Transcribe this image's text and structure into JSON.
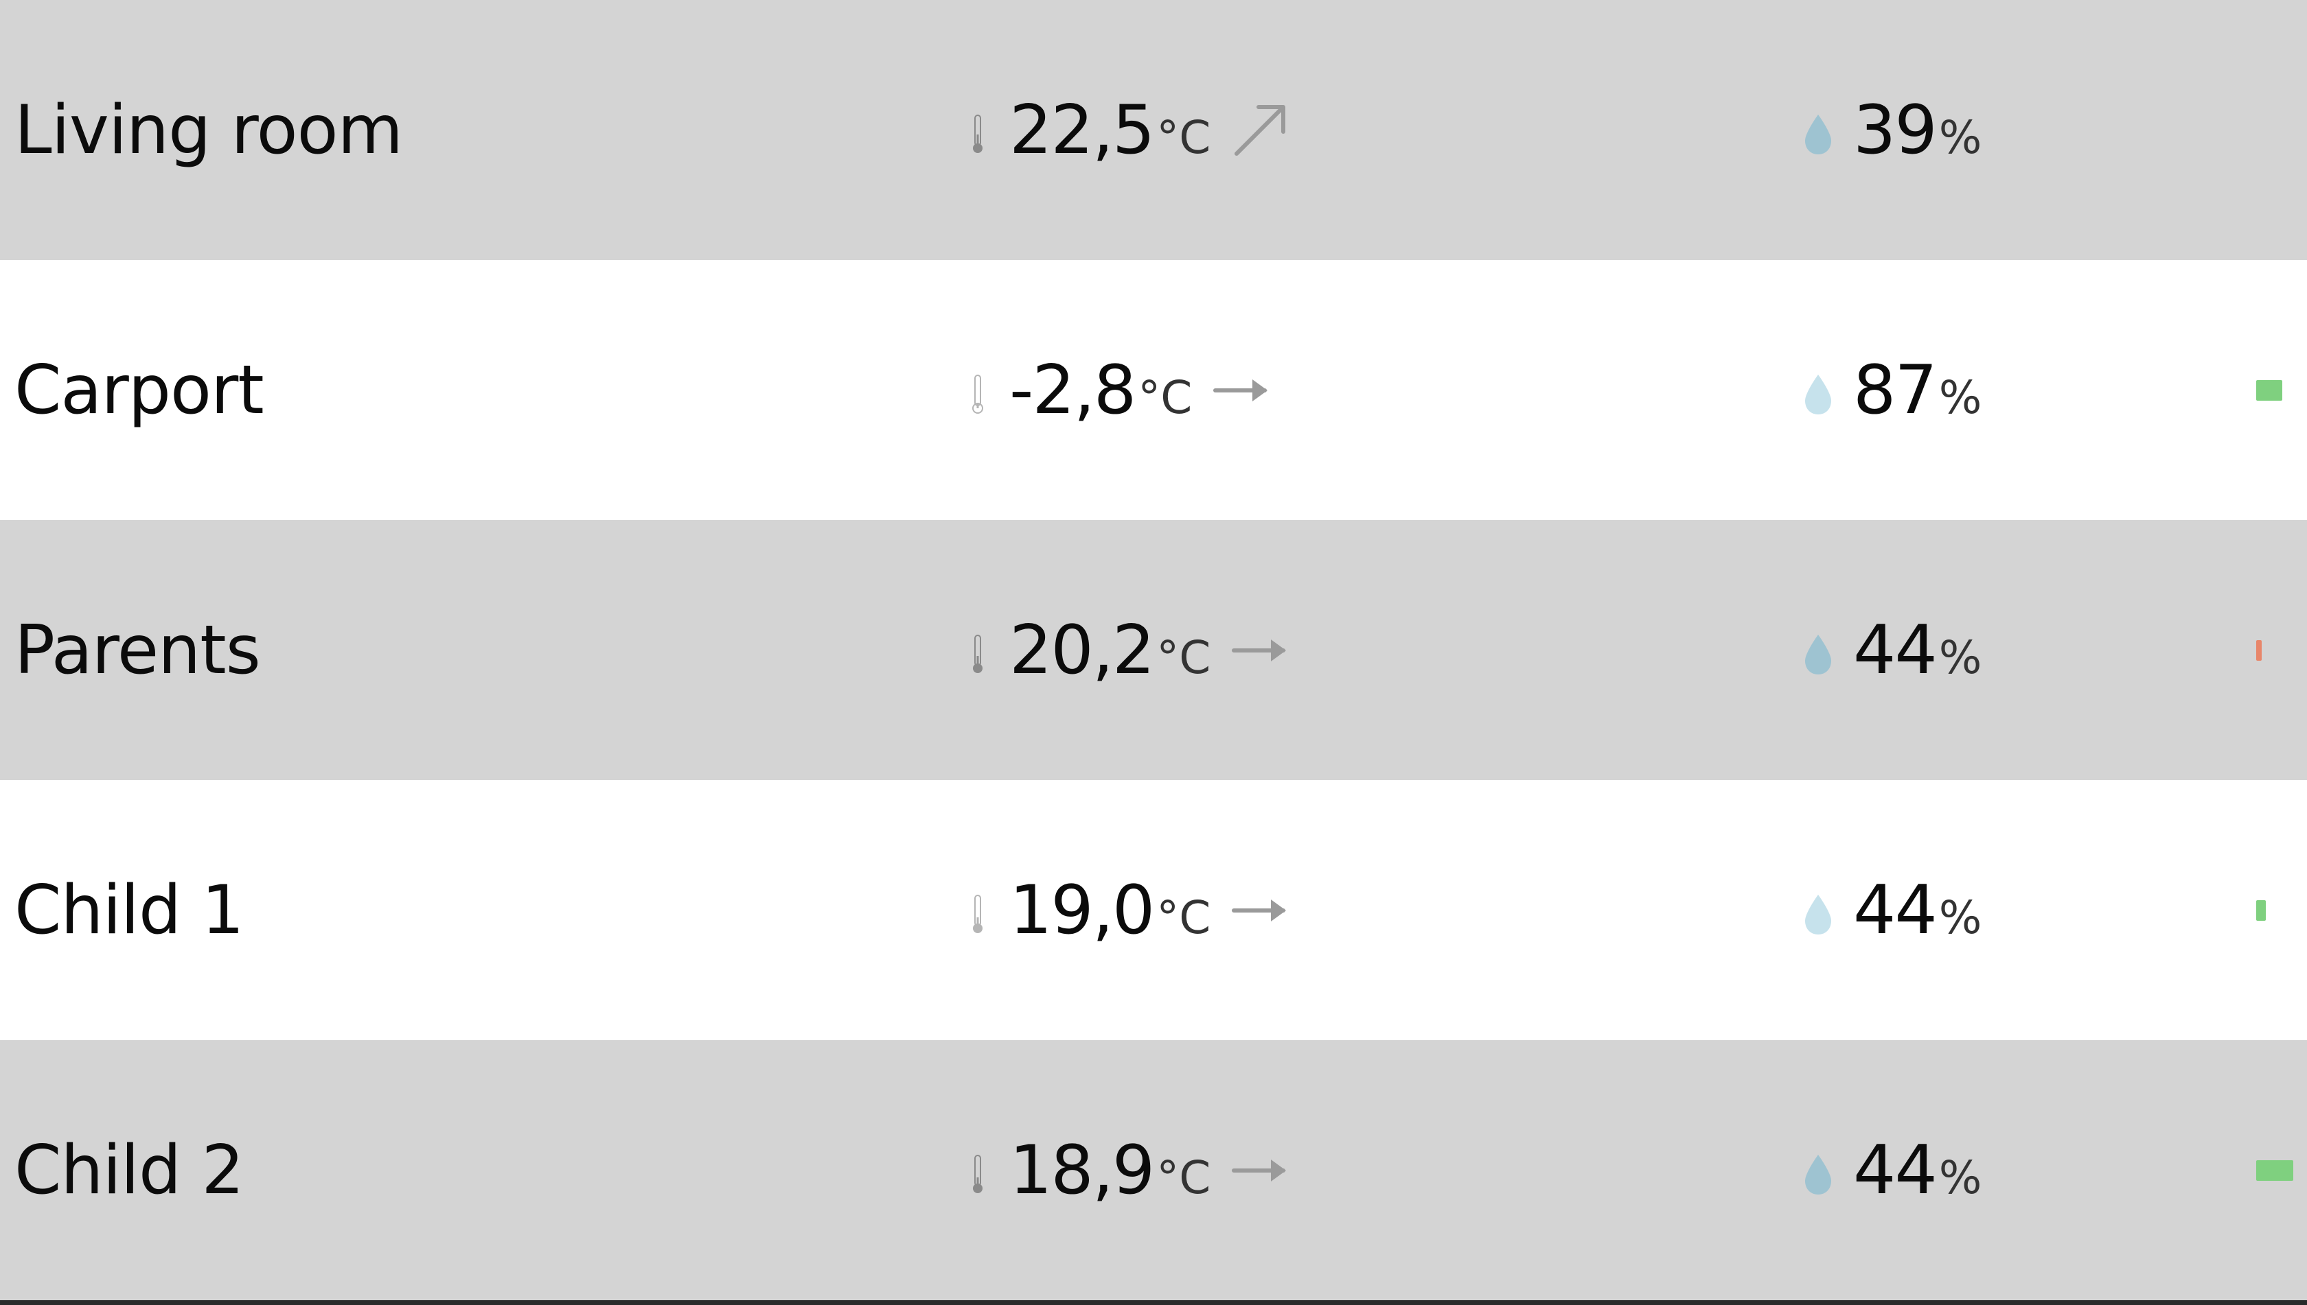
{
  "colors": {
    "row_shade": "#d4d4d4",
    "row_plain": "#ffffff",
    "trend_arrow": "#9a9a9a",
    "thermometer": "#8a8a8a",
    "battery_good": "#7fd07f",
    "battery_low": "#e8866a"
  },
  "icons": {
    "temperature": "thermometer-icon",
    "humidity": "water-drop-icon",
    "trend_rising": "arrow-up-right-icon",
    "trend_steady": "arrow-right-icon",
    "battery": "battery-level-bar"
  },
  "rooms": [
    {
      "name": "Living room",
      "temperature": "22,5",
      "temperature_unit": "°C",
      "trend": "rising",
      "humidity": "39",
      "humidity_unit": "%",
      "drop_color": "#9ec3d1",
      "battery_level": null,
      "battery_color": null
    },
    {
      "name": "Carport",
      "temperature": "-2,8",
      "temperature_unit": "°C",
      "trend": "steady",
      "humidity": "87",
      "humidity_unit": "%",
      "drop_color": "#c6e2ec",
      "battery_level": 0.7,
      "battery_color": "#7fd07f"
    },
    {
      "name": "Parents",
      "temperature": "20,2",
      "temperature_unit": "°C",
      "trend": "steady",
      "humidity": "44",
      "humidity_unit": "%",
      "drop_color": "#9ec3d1",
      "battery_level": 0.15,
      "battery_color": "#e8866a"
    },
    {
      "name": "Child 1",
      "temperature": "19,0",
      "temperature_unit": "°C",
      "trend": "steady",
      "humidity": "44",
      "humidity_unit": "%",
      "drop_color": "#c6e2ec",
      "battery_level": 0.25,
      "battery_color": "#7fd07f"
    },
    {
      "name": "Child 2",
      "temperature": "18,9",
      "temperature_unit": "°C",
      "trend": "steady",
      "humidity": "44",
      "humidity_unit": "%",
      "drop_color": "#9ec3d1",
      "battery_level": 1.0,
      "battery_color": "#7fd07f"
    }
  ]
}
